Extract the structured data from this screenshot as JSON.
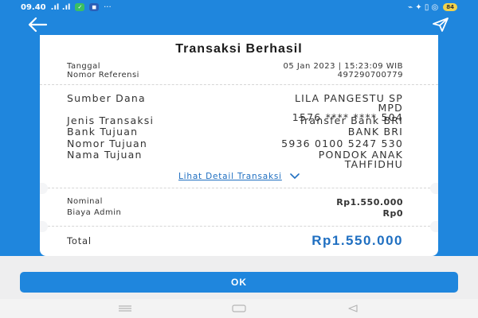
{
  "status_bar": {
    "time": "09.40",
    "signal": ".ıl .ıl",
    "badge1": "✓",
    "badge2": "◼",
    "dots": "···",
    "right_icons": "⌁ ✦ ▯ ◎",
    "battery": "84"
  },
  "appbar": {
    "back_icon": "arrow-left",
    "share_icon": "send"
  },
  "receipt": {
    "title": "Transaksi Berhasil",
    "date_label": "Tanggal",
    "date_value": "05 Jan 2023 | 15:23:09 WIB",
    "ref_label": "Nomor Referensi",
    "ref_value": "497290700779",
    "source_label": "Sumber Dana",
    "source_name_line1": "LILA PANGESTU SP",
    "source_name_line2": "MPD",
    "source_account": "1576 **** **** 504",
    "type_label": "Jenis Transaksi",
    "type_value": "Transfer Bank BRI",
    "bank_label": "Bank Tujuan",
    "bank_value": "BANK BRI",
    "dest_no_label": "Nomor Tujuan",
    "dest_no_value": "5936 0100 5247 530",
    "dest_name_label": "Nama Tujuan",
    "dest_name_line1": "PONDOK ANAK",
    "dest_name_line2": "TAHFIDHU",
    "detail_link": "Lihat Detail Transaksi",
    "nominal_label": "Nominal",
    "nominal_value": "Rp1.550.000",
    "fee_label": "Biaya Admin",
    "fee_value": "Rp0",
    "total_label": "Total",
    "total_value": "Rp1.550.000"
  },
  "ok_button": "OK",
  "colors": {
    "primary": "#1f86dd",
    "link": "#1f6fc1"
  }
}
